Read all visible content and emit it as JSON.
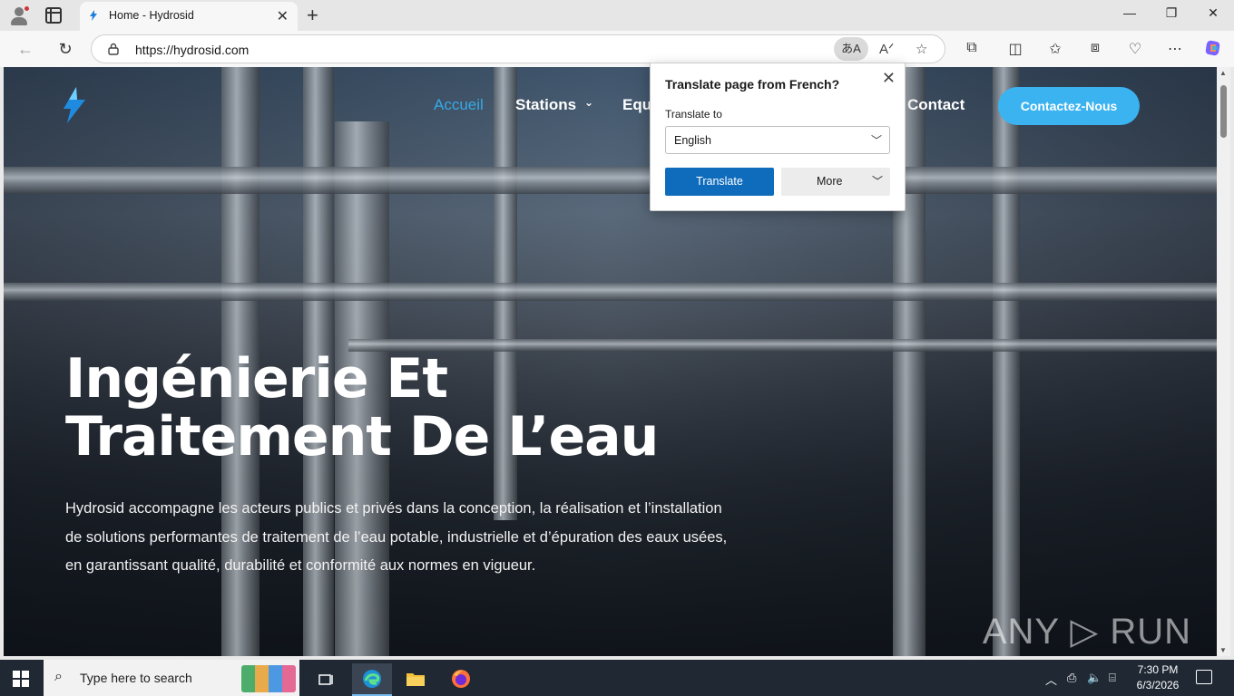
{
  "browser": {
    "tab_title": "Home - Hydrosid",
    "url": "https://hydrosid.com",
    "translate_pill": "あA",
    "new_tab": "+",
    "tab_close": "✕"
  },
  "popup": {
    "title": "Translate page from French?",
    "label": "Translate to",
    "selected_language": "English",
    "translate_button": "Translate",
    "more_button": "More"
  },
  "site": {
    "nav": [
      "Accueil",
      "Stations",
      "Equ",
      "Contact"
    ],
    "cta": "Contactez-Nous",
    "hero_title_line1": "Ingénierie Et",
    "hero_title_line2": "Traitement De L’eau",
    "hero_text": "Hydrosid accompagne les acteurs publics et privés dans la conception, la réalisation et l’installation de solutions performantes de traitement de l’eau potable, industrielle et d’épuration des eaux usées, en garantissant qualité, durabilité et conformité aux normes en vigueur.",
    "watermark": "ANY ▷ RUN"
  },
  "taskbar": {
    "search_placeholder": "Type here to search",
    "time": "7:30 PM",
    "date": "6/3/2026"
  },
  "colors": {
    "accent_blue": "#3ab3f0",
    "translate_blue": "#0f6cbd",
    "nav_active": "#38a9e6"
  }
}
